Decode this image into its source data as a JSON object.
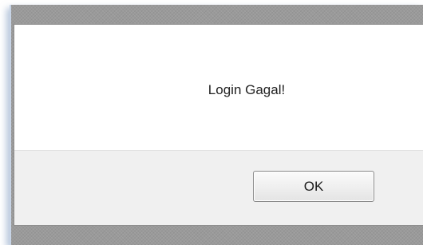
{
  "dialog": {
    "message": "Login Gagal!",
    "ok_label": "OK"
  }
}
